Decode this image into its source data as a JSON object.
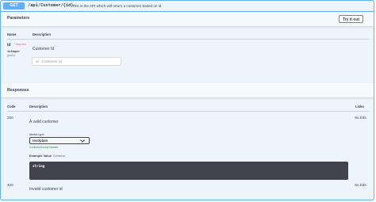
{
  "summary": {
    "method": "GET",
    "path": "/api/Customer/{id}",
    "description": "This is the API which will return a customer based on id"
  },
  "parameters": {
    "title": "Parameters",
    "try_button": "Try it out",
    "col_name": "Name",
    "col_description": "Description",
    "param": {
      "name": "id",
      "required": "* required",
      "type": "integer",
      "location": "(path)",
      "description": "Customer Id",
      "placeholder": "id - Customer Id"
    }
  },
  "responses": {
    "title": "Responses",
    "col_code": "Code",
    "col_description": "Description",
    "col_links": "Links",
    "items": [
      {
        "code": "200",
        "description": "A valid customer",
        "links": "No links",
        "media_type_label": "Media type",
        "media_type_value": "text/plain",
        "controls_text": "Controls Accept header.",
        "example_tab": "Example Value",
        "schema_tab": "Schema",
        "example": "string"
      },
      {
        "code": "400",
        "description": "Invalid customer id",
        "links": "No links"
      }
    ]
  },
  "colors": {
    "get": "#61affe",
    "background": "#edf4fb",
    "required": "#ff6060",
    "example_bg": "#41444e"
  }
}
